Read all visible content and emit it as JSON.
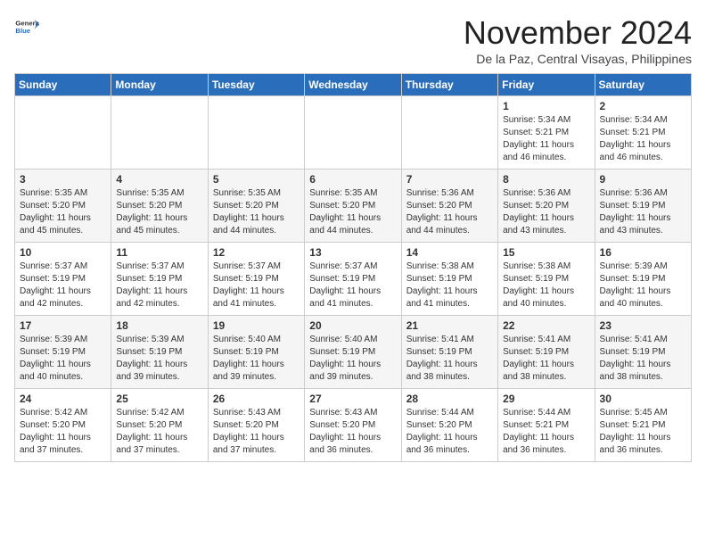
{
  "header": {
    "logo_general": "General",
    "logo_blue": "Blue",
    "month": "November 2024",
    "location": "De la Paz, Central Visayas, Philippines"
  },
  "weekdays": [
    "Sunday",
    "Monday",
    "Tuesday",
    "Wednesday",
    "Thursday",
    "Friday",
    "Saturday"
  ],
  "weeks": [
    [
      {
        "day": "",
        "info": ""
      },
      {
        "day": "",
        "info": ""
      },
      {
        "day": "",
        "info": ""
      },
      {
        "day": "",
        "info": ""
      },
      {
        "day": "",
        "info": ""
      },
      {
        "day": "1",
        "info": "Sunrise: 5:34 AM\nSunset: 5:21 PM\nDaylight: 11 hours\nand 46 minutes."
      },
      {
        "day": "2",
        "info": "Sunrise: 5:34 AM\nSunset: 5:21 PM\nDaylight: 11 hours\nand 46 minutes."
      }
    ],
    [
      {
        "day": "3",
        "info": "Sunrise: 5:35 AM\nSunset: 5:20 PM\nDaylight: 11 hours\nand 45 minutes."
      },
      {
        "day": "4",
        "info": "Sunrise: 5:35 AM\nSunset: 5:20 PM\nDaylight: 11 hours\nand 45 minutes."
      },
      {
        "day": "5",
        "info": "Sunrise: 5:35 AM\nSunset: 5:20 PM\nDaylight: 11 hours\nand 44 minutes."
      },
      {
        "day": "6",
        "info": "Sunrise: 5:35 AM\nSunset: 5:20 PM\nDaylight: 11 hours\nand 44 minutes."
      },
      {
        "day": "7",
        "info": "Sunrise: 5:36 AM\nSunset: 5:20 PM\nDaylight: 11 hours\nand 44 minutes."
      },
      {
        "day": "8",
        "info": "Sunrise: 5:36 AM\nSunset: 5:20 PM\nDaylight: 11 hours\nand 43 minutes."
      },
      {
        "day": "9",
        "info": "Sunrise: 5:36 AM\nSunset: 5:19 PM\nDaylight: 11 hours\nand 43 minutes."
      }
    ],
    [
      {
        "day": "10",
        "info": "Sunrise: 5:37 AM\nSunset: 5:19 PM\nDaylight: 11 hours\nand 42 minutes."
      },
      {
        "day": "11",
        "info": "Sunrise: 5:37 AM\nSunset: 5:19 PM\nDaylight: 11 hours\nand 42 minutes."
      },
      {
        "day": "12",
        "info": "Sunrise: 5:37 AM\nSunset: 5:19 PM\nDaylight: 11 hours\nand 41 minutes."
      },
      {
        "day": "13",
        "info": "Sunrise: 5:37 AM\nSunset: 5:19 PM\nDaylight: 11 hours\nand 41 minutes."
      },
      {
        "day": "14",
        "info": "Sunrise: 5:38 AM\nSunset: 5:19 PM\nDaylight: 11 hours\nand 41 minutes."
      },
      {
        "day": "15",
        "info": "Sunrise: 5:38 AM\nSunset: 5:19 PM\nDaylight: 11 hours\nand 40 minutes."
      },
      {
        "day": "16",
        "info": "Sunrise: 5:39 AM\nSunset: 5:19 PM\nDaylight: 11 hours\nand 40 minutes."
      }
    ],
    [
      {
        "day": "17",
        "info": "Sunrise: 5:39 AM\nSunset: 5:19 PM\nDaylight: 11 hours\nand 40 minutes."
      },
      {
        "day": "18",
        "info": "Sunrise: 5:39 AM\nSunset: 5:19 PM\nDaylight: 11 hours\nand 39 minutes."
      },
      {
        "day": "19",
        "info": "Sunrise: 5:40 AM\nSunset: 5:19 PM\nDaylight: 11 hours\nand 39 minutes."
      },
      {
        "day": "20",
        "info": "Sunrise: 5:40 AM\nSunset: 5:19 PM\nDaylight: 11 hours\nand 39 minutes."
      },
      {
        "day": "21",
        "info": "Sunrise: 5:41 AM\nSunset: 5:19 PM\nDaylight: 11 hours\nand 38 minutes."
      },
      {
        "day": "22",
        "info": "Sunrise: 5:41 AM\nSunset: 5:19 PM\nDaylight: 11 hours\nand 38 minutes."
      },
      {
        "day": "23",
        "info": "Sunrise: 5:41 AM\nSunset: 5:19 PM\nDaylight: 11 hours\nand 38 minutes."
      }
    ],
    [
      {
        "day": "24",
        "info": "Sunrise: 5:42 AM\nSunset: 5:20 PM\nDaylight: 11 hours\nand 37 minutes."
      },
      {
        "day": "25",
        "info": "Sunrise: 5:42 AM\nSunset: 5:20 PM\nDaylight: 11 hours\nand 37 minutes."
      },
      {
        "day": "26",
        "info": "Sunrise: 5:43 AM\nSunset: 5:20 PM\nDaylight: 11 hours\nand 37 minutes."
      },
      {
        "day": "27",
        "info": "Sunrise: 5:43 AM\nSunset: 5:20 PM\nDaylight: 11 hours\nand 36 minutes."
      },
      {
        "day": "28",
        "info": "Sunrise: 5:44 AM\nSunset: 5:20 PM\nDaylight: 11 hours\nand 36 minutes."
      },
      {
        "day": "29",
        "info": "Sunrise: 5:44 AM\nSunset: 5:21 PM\nDaylight: 11 hours\nand 36 minutes."
      },
      {
        "day": "30",
        "info": "Sunrise: 5:45 AM\nSunset: 5:21 PM\nDaylight: 11 hours\nand 36 minutes."
      }
    ]
  ]
}
